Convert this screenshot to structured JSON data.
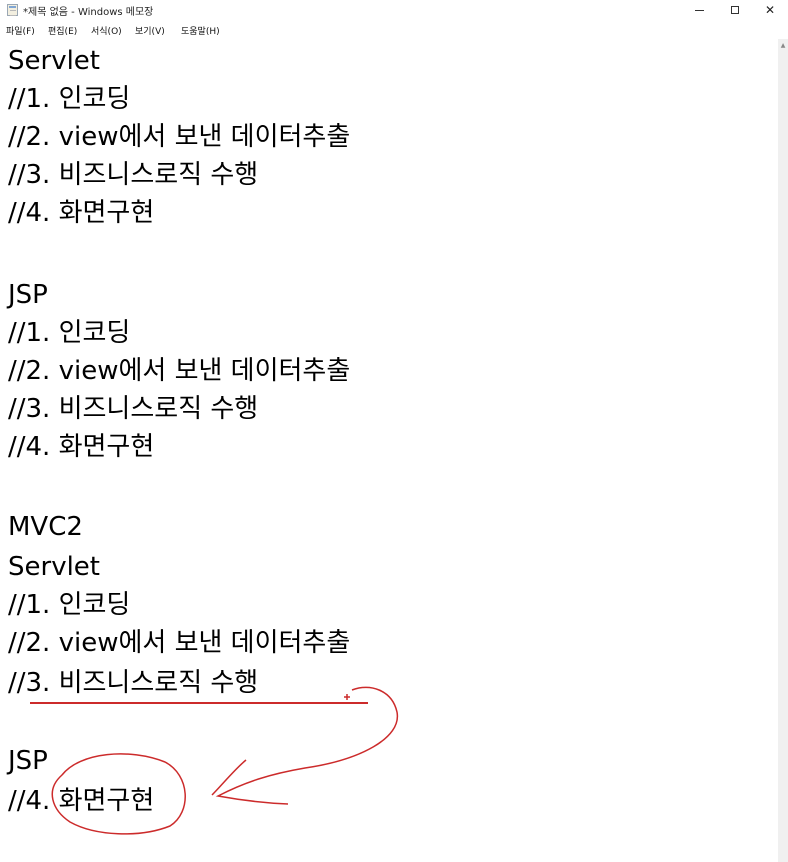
{
  "window": {
    "title": "*제목 없음 - Windows 메모장",
    "minimize_glyph": "—",
    "maximize_glyph": "☐",
    "close_glyph": "✕"
  },
  "menu": {
    "items": [
      {
        "label": "파일(F)"
      },
      {
        "label": "편집(E)"
      },
      {
        "label": "서식(O)"
      },
      {
        "label": "보기(V)"
      },
      {
        "label": "도움말(H)"
      }
    ]
  },
  "editor": {
    "lines": [
      "Servlet",
      "//1. 인코딩",
      "//2. view에서 보낸 데이터추출",
      "//3. 비즈니스로직 수행",
      "//4. 화면구현",
      "",
      "JSP",
      "//1. 인코딩",
      "//2. view에서 보낸 데이터추출",
      "//3. 비즈니스로직 수행",
      "//4. 화면구현",
      "",
      "MVC2",
      "Servlet",
      "//1. 인코딩",
      "//2. view에서 보낸 데이터추출",
      "//3. 비즈니스로직 수행",
      "",
      "JSP",
      "//4. 화면구현"
    ]
  },
  "scrollbar": {
    "up_arrow": "▲"
  },
  "annotation": {
    "pen_color": "#cc2b2b",
    "cursor_mark": "+"
  },
  "icons": [
    "notepad-icon",
    "minimize-icon",
    "maximize-icon",
    "close-icon",
    "scroll-up-icon"
  ]
}
